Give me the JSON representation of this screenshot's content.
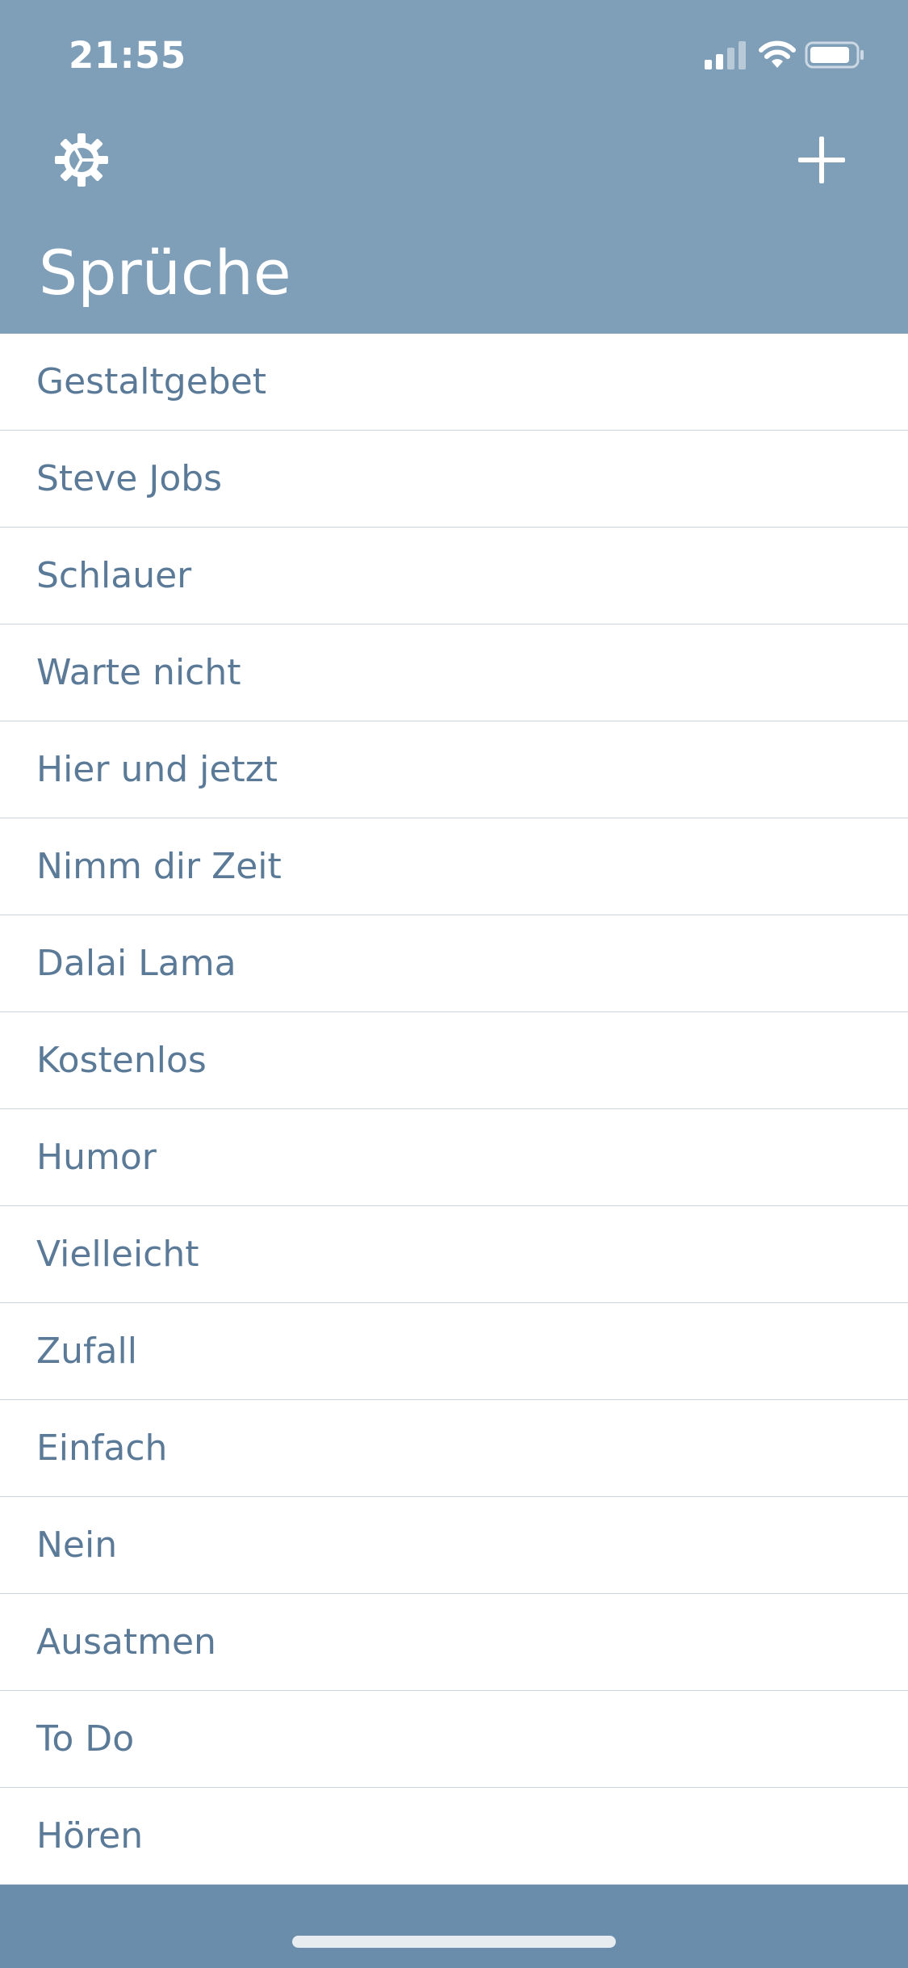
{
  "status_bar": {
    "time": "21:55",
    "signal_icon": "cellular-signal-icon",
    "wifi_icon": "wifi-icon",
    "battery_icon": "battery-icon"
  },
  "header": {
    "title": "Sprüche",
    "left_button_icon": "gear-icon",
    "right_button_icon": "plus-icon",
    "background_color": "#7f9fb9"
  },
  "list": {
    "items": [
      "Gestaltgebet",
      "Steve Jobs",
      "Schlauer",
      "Warte nicht",
      "Hier und jetzt",
      "Nimm dir Zeit",
      "Dalai Lama",
      "Kostenlos",
      "Humor",
      "Vielleicht",
      "Zufall",
      "Einfach",
      "Nein",
      "Ausatmen",
      "To Do",
      "Hören"
    ],
    "text_color": "#5a7a98",
    "separator_color": "#c9d3dd"
  },
  "bottom_bar": {
    "background_color": "#6a8dab"
  }
}
